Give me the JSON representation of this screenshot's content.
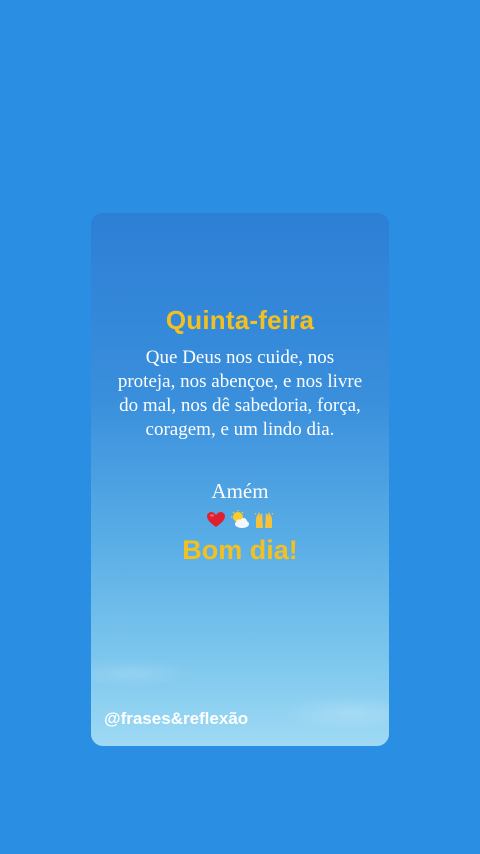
{
  "card": {
    "title": "Quinta-feira",
    "message": "Que Deus nos cuide, nos proteja, nos abençoe, e nos livre do mal, nos dê sabedoria, força, coragem, e um lindo dia.",
    "amen": "Amém",
    "greeting": "Bom dia!",
    "handle": "@frases&reflexão",
    "emojis": [
      "heart-icon",
      "sun-behind-cloud-icon",
      "raised-hands-icon"
    ]
  },
  "colors": {
    "background": "#2a8ee3",
    "accent_yellow": "#f3c021",
    "text_white": "#ffffff"
  }
}
